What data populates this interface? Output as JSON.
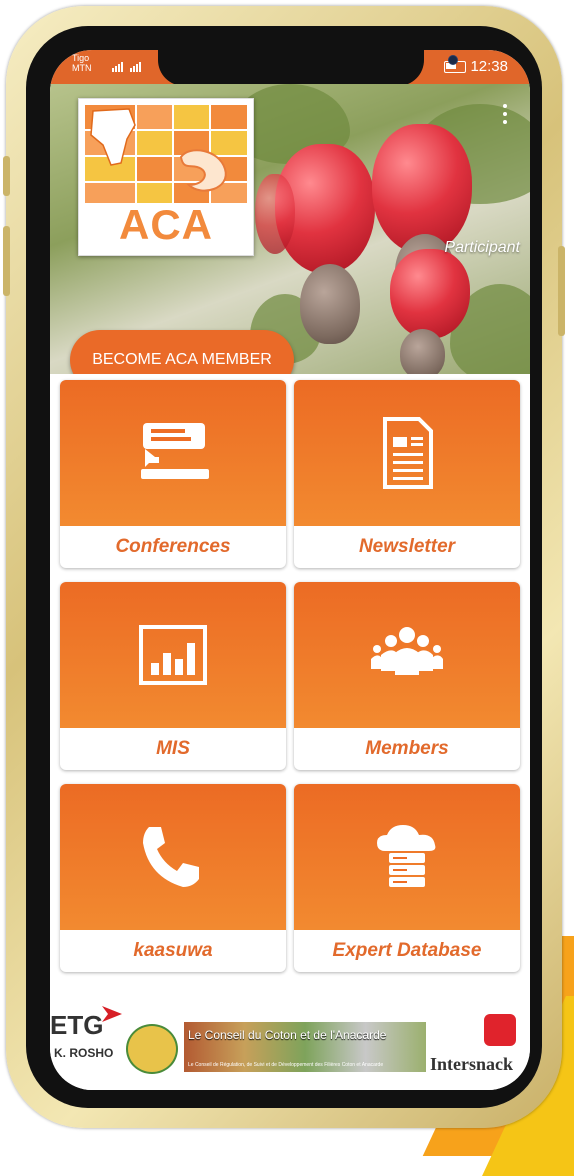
{
  "status_bar": {
    "carrier_top": "Tigo",
    "carrier_bottom": "MTN",
    "time": "12:38"
  },
  "header": {
    "logo_text": "ACA",
    "role_label": "Participant",
    "become_member_label": "BECOME ACA MEMBER"
  },
  "menu": {
    "tiles": [
      {
        "label": "Conferences",
        "icon": "conference-icon"
      },
      {
        "label": "Newsletter",
        "icon": "document-icon"
      },
      {
        "label": "MIS",
        "icon": "bar-chart-icon"
      },
      {
        "label": "Members",
        "icon": "group-icon"
      },
      {
        "label": "kaasuwa",
        "icon": "phone-icon"
      },
      {
        "label": "Expert Database",
        "icon": "cloud-server-icon"
      }
    ]
  },
  "sponsors": {
    "etg": "ETG",
    "rosho": "K. ROSHO",
    "conseil": "Le Conseil du Coton et de l'Anacarde",
    "conseil_sub": "Le Conseil de Régulation, de Suivi et de Développement des Filières Coton et Anacarde",
    "intersnack": "Intersnack"
  },
  "colors": {
    "accent": "#ea6a28",
    "tile_label": "#e26a2c"
  }
}
